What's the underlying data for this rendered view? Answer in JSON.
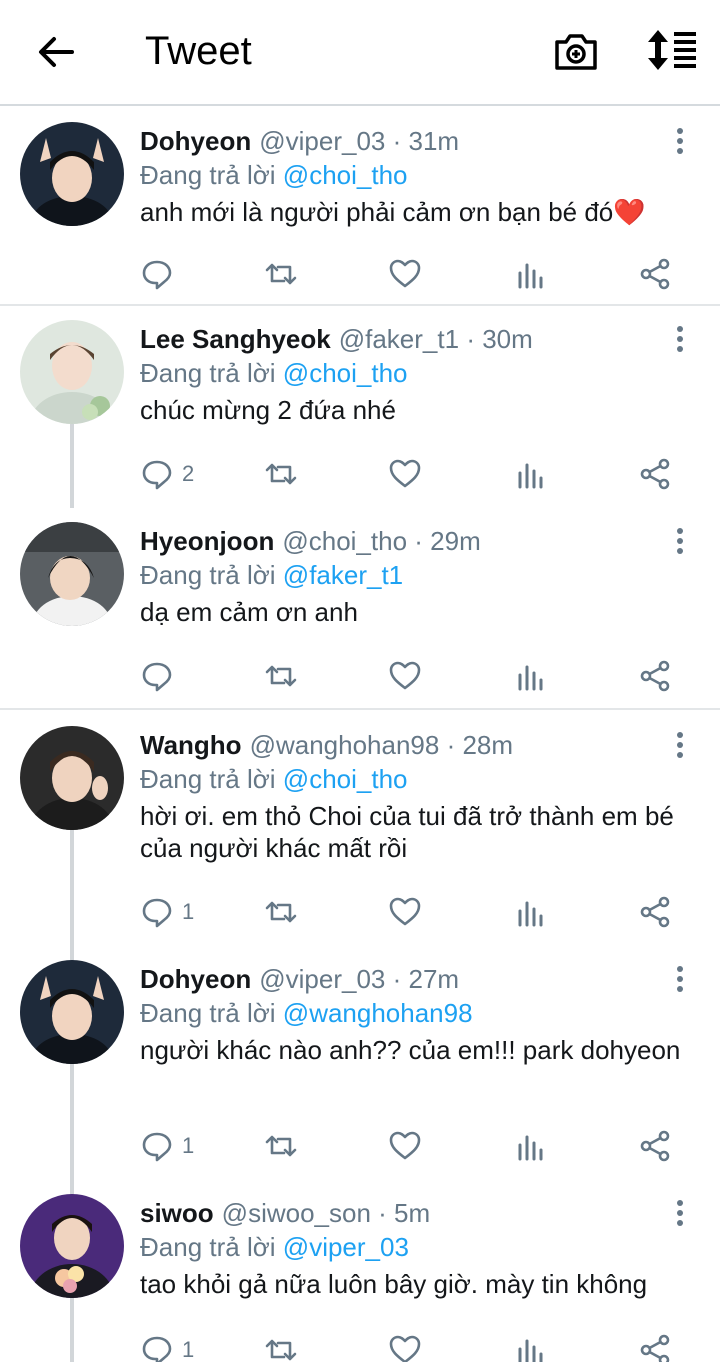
{
  "header": {
    "back_icon": "arrow-left-icon",
    "title": "Tweet",
    "camera_icon": "camera-plus-icon",
    "sort_icon": "sort-updown-icon"
  },
  "replying_label": "Đang trả lời",
  "tweets": [
    {
      "name": "Dohyeon",
      "handle": "@viper_03",
      "time": "· 31m",
      "reply_to": "@choi_tho",
      "text": "anh mới là người phải cảm ơn bạn bé đó❤️",
      "reply_count": "",
      "avatar_color": "#1e2a3a"
    },
    {
      "name": "Lee Sanghyeok",
      "handle": "@faker_t1",
      "time": "· 30m",
      "reply_to": "@choi_tho",
      "text": "chúc mừng 2 đứa nhé",
      "reply_count": "2",
      "avatar_color": "#dfe7df"
    },
    {
      "name": "Hyeonjoon",
      "handle": "@choi_tho",
      "time": "· 29m",
      "reply_to": "@faker_t1",
      "text": "dạ em cảm ơn anh",
      "reply_count": "",
      "avatar_color": "#5a5f63"
    },
    {
      "name": "Wangho",
      "handle": "@wanghohan98",
      "time": "· 28m",
      "reply_to": "@choi_tho",
      "text": "hời ơi. em thỏ Choi của tui đã trở thành em bé của người khác mất rồi",
      "reply_count": "1",
      "avatar_color": "#2b2b2b"
    },
    {
      "name": "Dohyeon",
      "handle": "@viper_03",
      "time": "· 27m",
      "reply_to": "@wanghohan98",
      "text": "người khác nào anh?? của em!!! park dohyeon",
      "reply_count": "1",
      "avatar_color": "#1e2a3a"
    },
    {
      "name": "siwoo",
      "handle": "@siwoo_son",
      "time": "· 5m",
      "reply_to": "@viper_03",
      "text": "tao khỏi gả nữa luôn bây giờ. mày tin không",
      "reply_count": "1",
      "avatar_color": "#4a2a7a"
    }
  ],
  "colors": {
    "accent": "#1da1f2",
    "secondary_text": "#657786",
    "divider": "#e3e6e8",
    "heart": "#e0245e"
  }
}
